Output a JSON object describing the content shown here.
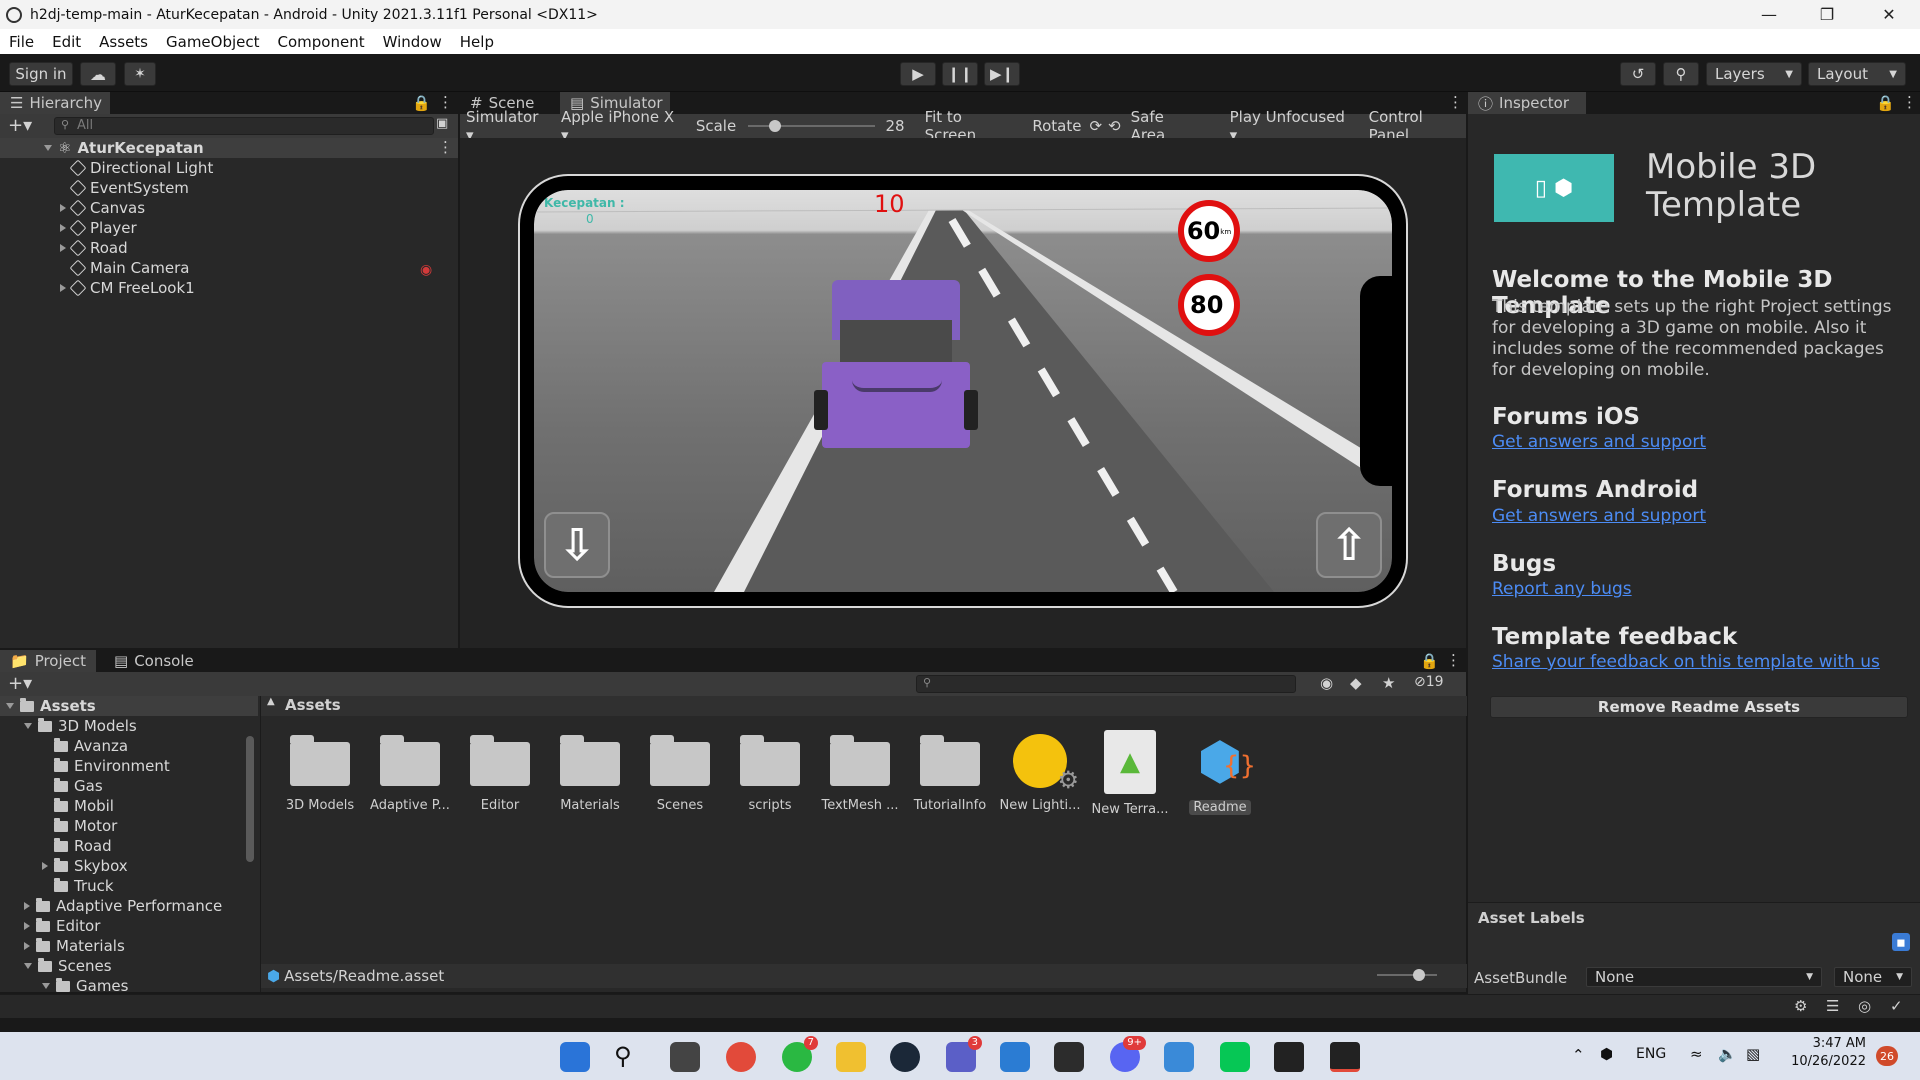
{
  "window": {
    "title": "h2dj-temp-main - AturKecepatan - Android - Unity 2021.3.11f1 Personal <DX11>"
  },
  "menu": [
    "File",
    "Edit",
    "Assets",
    "GameObject",
    "Component",
    "Window",
    "Help"
  ],
  "toolbar": {
    "sign_in": "Sign in",
    "layers": "Layers",
    "layout": "Layout"
  },
  "hierarchy": {
    "tab": "Hierarchy",
    "search_placeholder": "All",
    "scene": "AturKecepatan",
    "items": [
      {
        "label": "Directional Light",
        "expandable": false
      },
      {
        "label": "EventSystem",
        "expandable": false
      },
      {
        "label": "Canvas",
        "expandable": true
      },
      {
        "label": "Player",
        "expandable": true
      },
      {
        "label": "Road",
        "expandable": true
      },
      {
        "label": "Main Camera",
        "expandable": false
      },
      {
        "label": "CM FreeLook1",
        "expandable": true
      }
    ]
  },
  "center": {
    "tabs": {
      "scene": "Scene",
      "simulator": "Simulator"
    },
    "controls": {
      "mode": "Simulator",
      "device": "Apple iPhone X",
      "scale_label": "Scale",
      "scale_value": "28",
      "scale_fraction": 0.18,
      "fit": "Fit to Screen",
      "rotate": "Rotate",
      "safe_area": "Safe Area",
      "play_mode": "Play Unfocused",
      "control_panel": "Control Panel"
    },
    "game": {
      "speed_label": "Kecepatan :",
      "speed_value": "0",
      "counter": "10",
      "sign1": "60",
      "sign1_unit": "km",
      "sign2": "80"
    }
  },
  "inspector": {
    "tab": "Inspector",
    "template_title": "Mobile 3D Template",
    "welcome_heading": "Welcome to the Mobile 3D Template",
    "welcome_text": "This template sets up the right Project settings for developing a 3D game on mobile. Also it includes some of the recommended packages for developing on mobile.",
    "sections": [
      {
        "heading": "Forums iOS",
        "link": "Get answers and support"
      },
      {
        "heading": "Forums Android",
        "link": "Get answers and support"
      },
      {
        "heading": "Bugs",
        "link": "Report any bugs"
      },
      {
        "heading": "Template feedback",
        "link": "Share your feedback on this template with us"
      }
    ],
    "remove_button": "Remove Readme Assets",
    "asset_labels": "Asset Labels",
    "asset_bundle_label": "AssetBundle",
    "bundle_value": "None",
    "variant_value": "None"
  },
  "project": {
    "tabs": {
      "project": "Project",
      "console": "Console"
    },
    "hidden_count": "19",
    "tree_root": "Assets",
    "tree": [
      {
        "label": "3D Models",
        "level": 1,
        "state": "open"
      },
      {
        "label": "Avanza",
        "level": 2,
        "state": "leaf"
      },
      {
        "label": "Environment",
        "level": 2,
        "state": "leaf"
      },
      {
        "label": "Gas",
        "level": 2,
        "state": "leaf"
      },
      {
        "label": "Mobil",
        "level": 2,
        "state": "leaf"
      },
      {
        "label": "Motor",
        "level": 2,
        "state": "leaf"
      },
      {
        "label": "Road",
        "level": 2,
        "state": "leaf"
      },
      {
        "label": "Skybox",
        "level": 2,
        "state": "closed"
      },
      {
        "label": "Truck",
        "level": 2,
        "state": "leaf"
      },
      {
        "label": "Adaptive Performance",
        "level": 1,
        "state": "closed"
      },
      {
        "label": "Editor",
        "level": 1,
        "state": "closed"
      },
      {
        "label": "Materials",
        "level": 1,
        "state": "closed"
      },
      {
        "label": "Scenes",
        "level": 1,
        "state": "open"
      },
      {
        "label": "Games",
        "level": 2,
        "state": "open"
      }
    ],
    "breadcrumb": "Assets",
    "assets": [
      {
        "label": "3D Models",
        "kind": "folder"
      },
      {
        "label": "Adaptive P...",
        "kind": "folder"
      },
      {
        "label": "Editor",
        "kind": "folder"
      },
      {
        "label": "Materials",
        "kind": "folder"
      },
      {
        "label": "Scenes",
        "kind": "folder"
      },
      {
        "label": "scripts",
        "kind": "folder"
      },
      {
        "label": "TextMesh ...",
        "kind": "folder"
      },
      {
        "label": "TutorialInfo",
        "kind": "folder"
      },
      {
        "label": "New Lighti...",
        "kind": "lighting"
      },
      {
        "label": "New Terra...",
        "kind": "terrain"
      },
      {
        "label": "Readme",
        "kind": "readme"
      }
    ],
    "footer_path": "Assets/Readme.asset"
  },
  "taskbar": {
    "badges": {
      "whatsapp": "7",
      "teams": "3",
      "discord": "9+",
      "notifications": "26"
    },
    "language": "ENG",
    "time": "3:47 AM",
    "date": "10/26/2022"
  },
  "colors": {
    "link": "#4c8cf5",
    "accent_teal": "#3fb8b0",
    "car_purple": "#8a60c6",
    "sign_red": "#e01010"
  }
}
